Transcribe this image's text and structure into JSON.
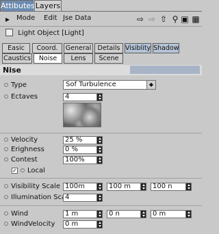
{
  "tabs": {
    "attributes": "Attibutes",
    "layers": "Layers"
  },
  "menu": {
    "mode": "Mode",
    "edit": "Edit",
    "user_data": "Jse Data",
    "icons": {
      "back": "arrow-left-icon",
      "forward": "arrow-right-icon",
      "up": "arrow-up-icon",
      "search": "search-icon",
      "lock": "lock-icon",
      "new_panel": "new-panel-icon"
    }
  },
  "object": {
    "title": "Light Object [Light]",
    "icon": "light-object-icon"
  },
  "subtabs": {
    "row1": [
      "Easic",
      "Coord.",
      "General",
      "Details",
      "Visiblity",
      "Shadow"
    ],
    "row2": [
      "Caustics",
      "Noise",
      "Lens",
      "Scene"
    ]
  },
  "section": {
    "title": "Nise"
  },
  "noise": {
    "type_label": "Type",
    "type_value": "Sof Turbulence",
    "octaves_label": "Ectaves",
    "octaves_value": "4",
    "velocity_label": "Velocity",
    "velocity_value": "25 %",
    "brightness_label": "Erighness",
    "brightness_value": "0 %",
    "contrast_label": "Contest",
    "contrast_value": "100%",
    "local_label": "Local",
    "local_check": "✓"
  },
  "scale": {
    "visibility_label": "Visibility Scale",
    "visibility_x": "100m",
    "visibility_y": "100 m",
    "visibility_z": "100 n",
    "illumination_label": "Illumination Scale",
    "illumination_value": "4"
  },
  "wind": {
    "wind_label": "Wind",
    "wind_x": "1 m",
    "wind_y": "0 n",
    "wind_z": "0 m",
    "velocity_label": "WindVelocity",
    "velocity_value": "0 m"
  }
}
